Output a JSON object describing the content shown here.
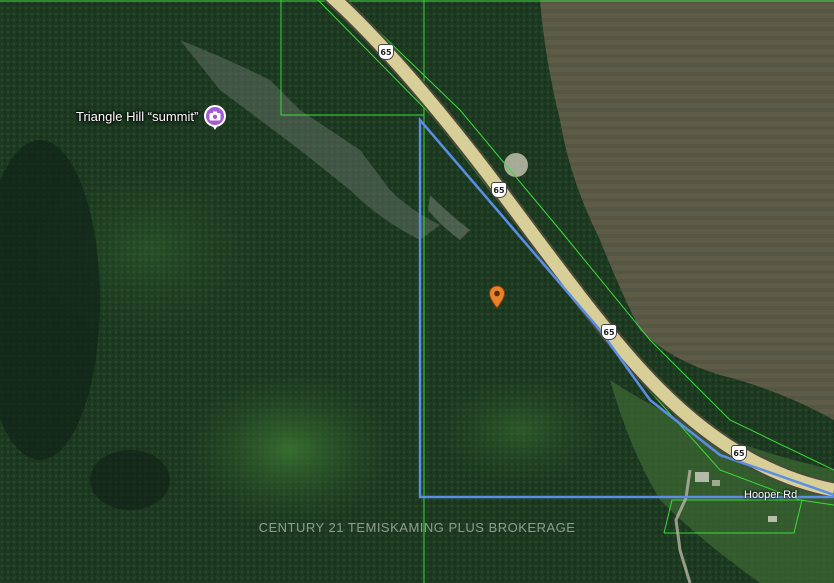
{
  "map": {
    "type": "satellite",
    "poi": {
      "label": "Triangle Hill “summit”",
      "icon": "camera-icon",
      "color": "#a35bd6"
    },
    "highway_shields": [
      "65",
      "65",
      "65",
      "65"
    ],
    "road_label": "Hooper Rd",
    "watermark": "CENTURY 21 TEMISKAMING PLUS BROKERAGE",
    "colors": {
      "parcel_boundary": "#5b8fe6",
      "lot_lines": "#3bdc3b",
      "highway": "#d8cf98",
      "pin": "#e8822a"
    }
  }
}
